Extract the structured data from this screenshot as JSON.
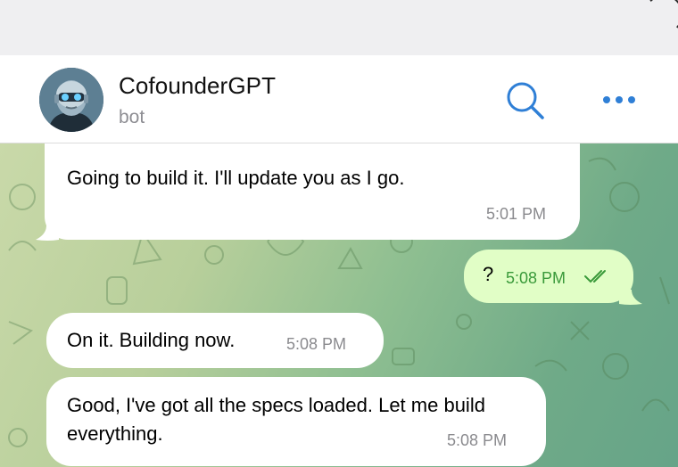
{
  "header": {
    "title": "CofounderGPT",
    "subtitle": "bot",
    "icons": [
      "avatar",
      "search-icon",
      "more-icon"
    ]
  },
  "messages": [
    {
      "sender": "bot",
      "text": "Going to build it. I'll update you as I go.",
      "time": "5:01 PM"
    },
    {
      "sender": "user",
      "text": "?",
      "time": "5:08 PM",
      "status": "read"
    },
    {
      "sender": "bot",
      "text": "On it. Building now.",
      "time": "5:08 PM"
    },
    {
      "sender": "bot",
      "text": "Good, I've got all the specs loaded. Let me build everything.",
      "time": "5:08 PM"
    }
  ],
  "colors": {
    "accent": "#2f7fd6",
    "outgoing_bubble": "#e1fec6",
    "incoming_bubble": "#ffffff",
    "read_check": "#3a9a3a"
  }
}
